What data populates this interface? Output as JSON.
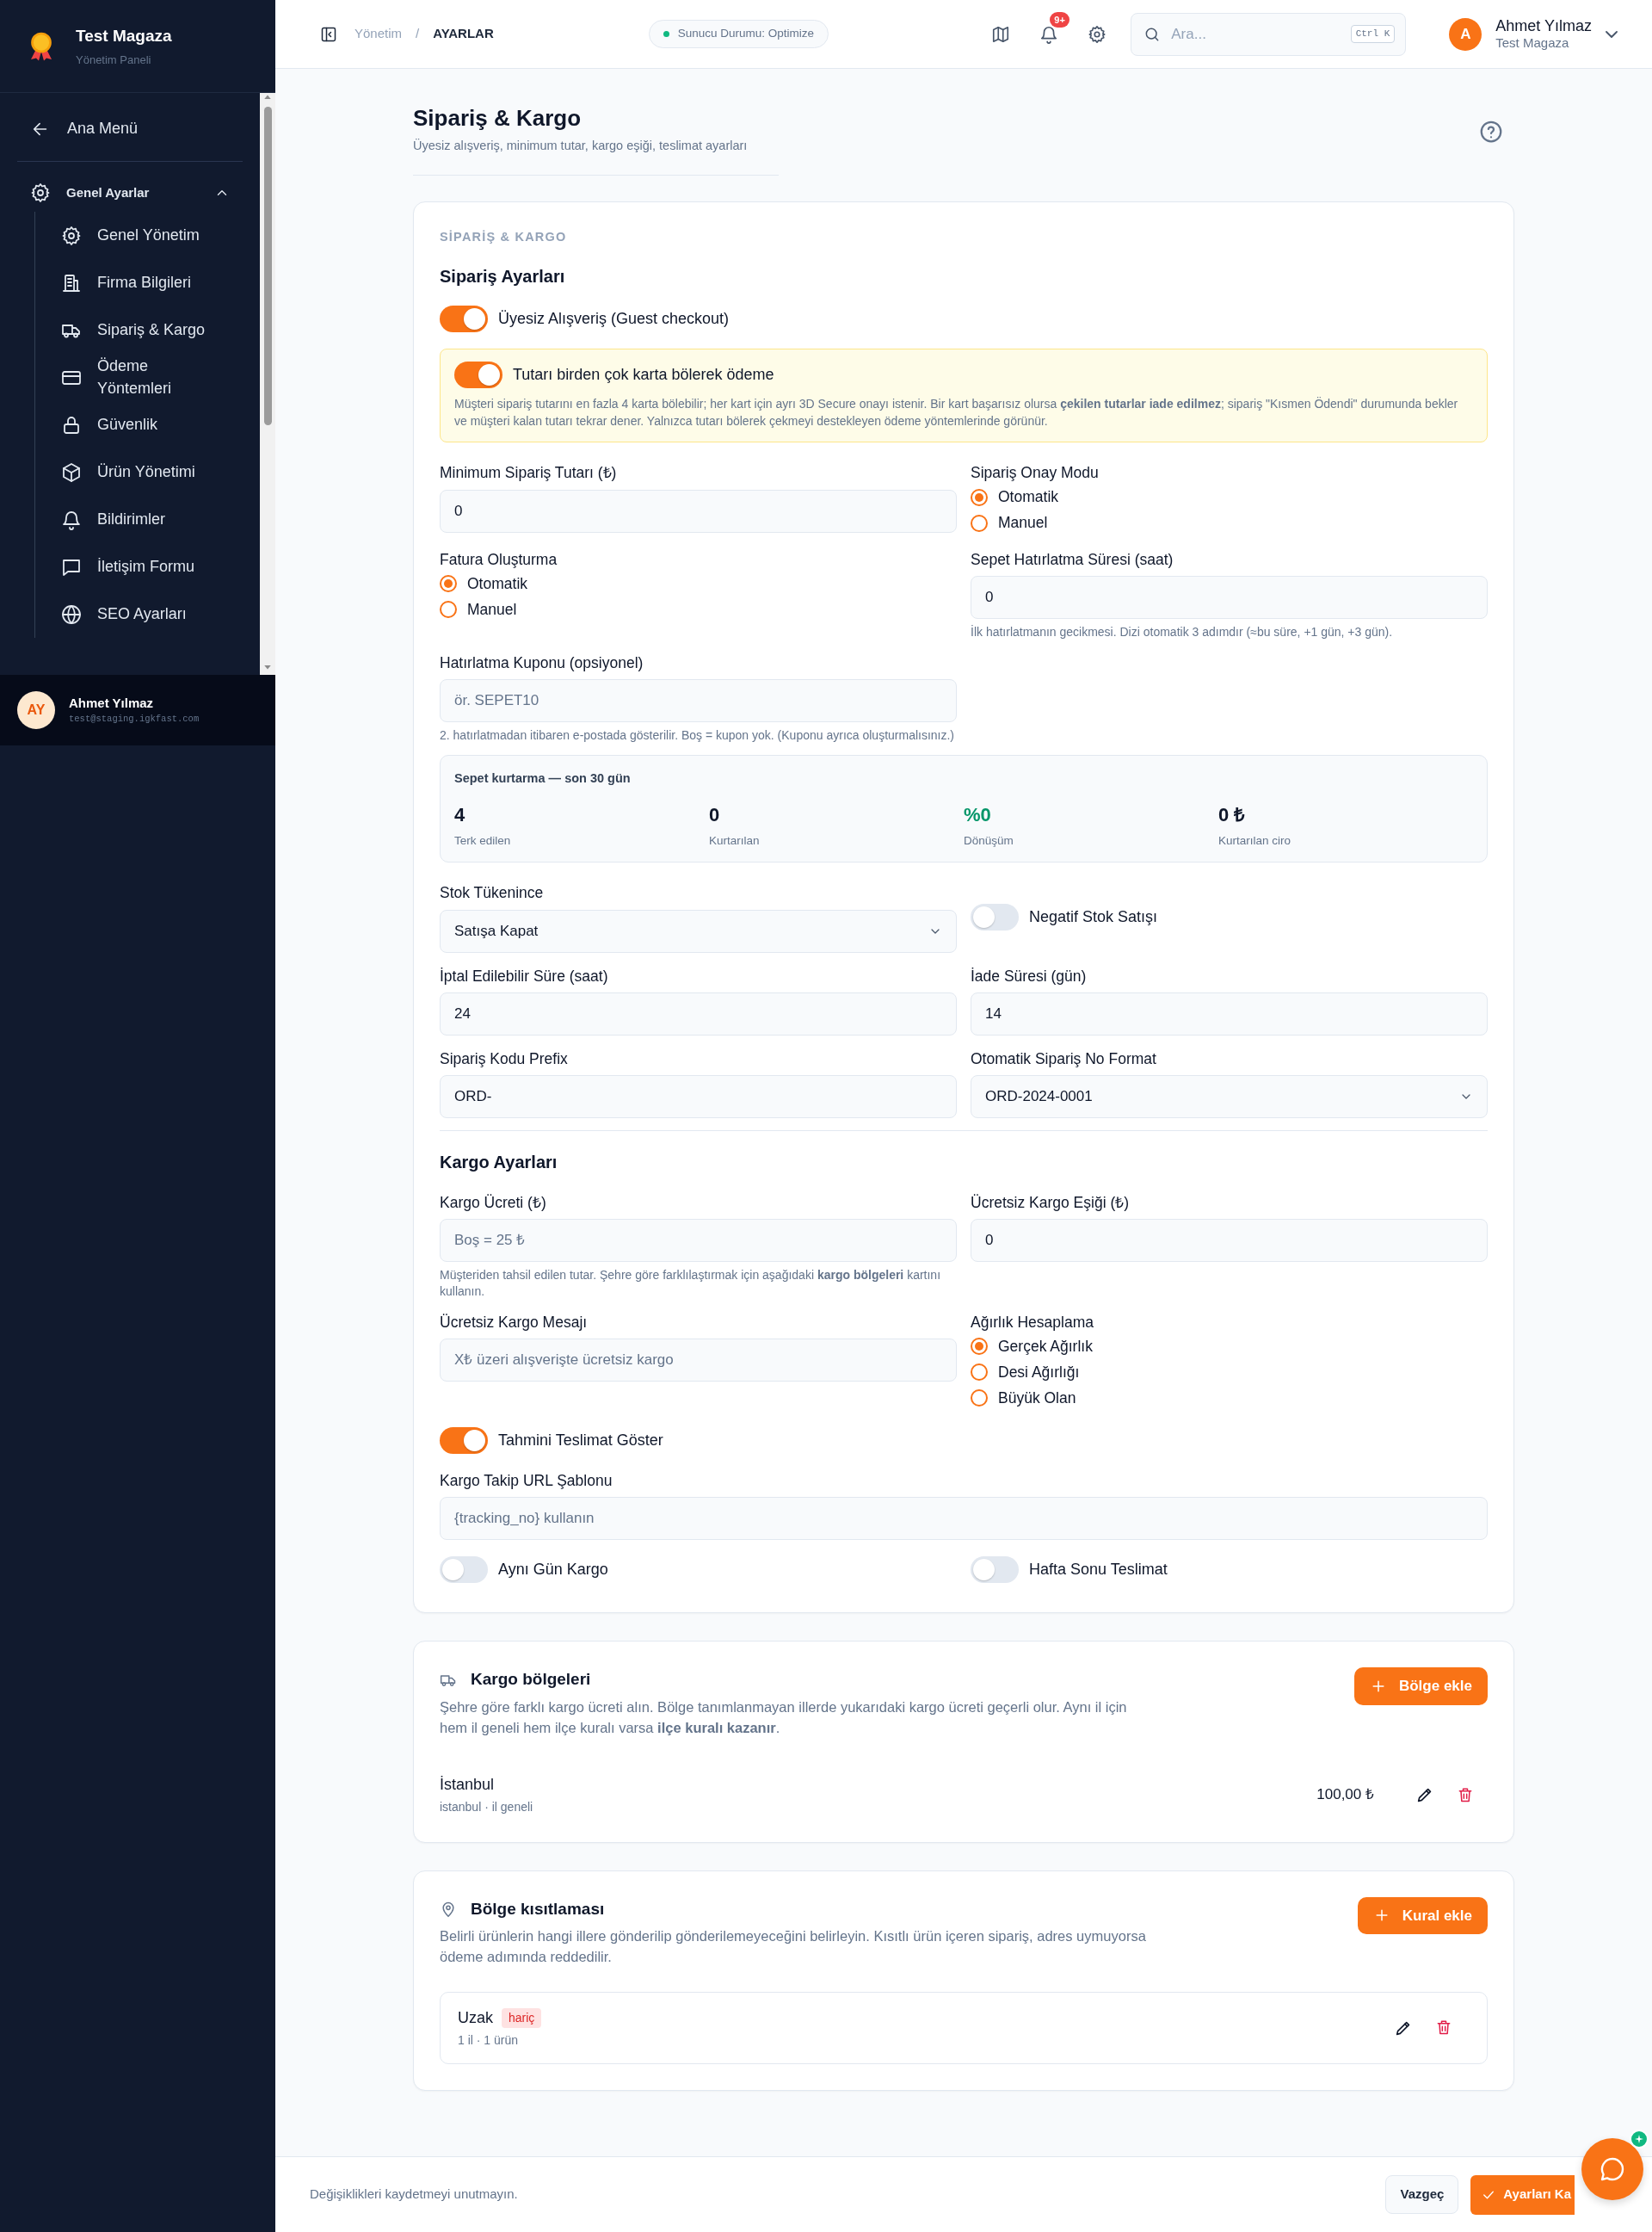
{
  "sidebar": {
    "brand": {
      "title": "Test Magaza",
      "subtitle": "Yönetim Paneli"
    },
    "back": "Ana Menü",
    "group": {
      "label": "Genel Ayarlar",
      "expanded": true,
      "items": [
        {
          "label": "Genel Yönetim"
        },
        {
          "label": "Firma Bilgileri"
        },
        {
          "label": "Sipariş & Kargo"
        },
        {
          "label": "Ödeme Yöntemleri"
        },
        {
          "label": "Güvenlik"
        },
        {
          "label": "Ürün Yönetimi"
        },
        {
          "label": "Bildirimler"
        },
        {
          "label": "İletişim Formu"
        },
        {
          "label": "SEO Ayarları"
        }
      ]
    },
    "user": {
      "initials": "AY",
      "name": "Ahmet Yılmaz",
      "email": "test@staging.igkfast.com"
    }
  },
  "header": {
    "breadcrumb": {
      "items": [
        "Yönetim",
        "AYARLAR"
      ],
      "separator": "/"
    },
    "status": "Sunucu Durumu: Optimize",
    "notifications": "9+",
    "search": {
      "placeholder": "Ara...",
      "shortcut": "Ctrl K"
    },
    "user": {
      "initial": "A",
      "name": "Ahmet Yılmaz",
      "store": "Test Magaza"
    }
  },
  "page": {
    "title": "Sipariş & Kargo",
    "subtitle": "Üyesiz alışveriş, minimum tutar, kargo eşiği, teslimat ayarları"
  },
  "settings": {
    "section_label": "SİPARİŞ & KARGO",
    "heading": "Sipariş Ayarları",
    "rows": [
      {
        "cells": [
          {
            "kind": "toggle",
            "label": "Üyesiz Alışveriş (Guest checkout)",
            "on": true
          }
        ]
      },
      {
        "cells": [
          {
            "kind": "notice",
            "wide": true,
            "label": "Tutarı birden çok karta bölerek ödeme",
            "on": true,
            "text": "Müşteri sipariş tutarını en fazla 4 karta bölebilir; her kart için ayrı 3D Secure onayı istenir. Bir kart başarısız olursa **çekilen tutarlar iade edilmez**; sipariş \"Kısmen Ödendi\" durumunda bekler ve müşteri kalan tutarı tekrar dener. Yalnızca tutarı bölerek çekmeyi destekleyen ödeme yöntemlerinde görünür."
          }
        ]
      },
      {
        "cells": [
          {
            "kind": "input",
            "label": "Minimum Sipariş Tutarı (₺)",
            "value": "0"
          },
          {
            "kind": "radio",
            "label": "Sipariş Onay Modu",
            "options": [
              {
                "label": "Otomatik",
                "selected": true
              },
              {
                "label": "Manuel",
                "selected": false
              }
            ]
          }
        ]
      },
      {
        "cells": [
          {
            "kind": "radio",
            "label": "Fatura Oluşturma",
            "options": [
              {
                "label": "Otomatik",
                "selected": true
              },
              {
                "label": "Manuel",
                "selected": false
              }
            ]
          },
          {
            "kind": "input",
            "label": "Sepet Hatırlatma Süresi (saat)",
            "value": "0",
            "hint": "İlk hatırlatmanın gecikmesi. Dizi otomatik 3 adımdır (≈bu süre, +1 gün, +3 gün)."
          }
        ]
      },
      {
        "cells": [
          {
            "kind": "input",
            "label": "Hatırlatma Kuponu (opsiyonel)",
            "placeholder": "ör. SEPET10",
            "hint": "2. hatırlatmadan itibaren e-postada gösterilir. Boş = kupon yok. (Kuponu ayrıca oluşturmalısınız.)"
          }
        ]
      },
      {
        "cells": [
          {
            "kind": "stats",
            "wide": true,
            "title": "Sepet kurtarma — son 30 gün",
            "items": [
              {
                "value": "4",
                "label": "Terk edilen",
                "color": "#0f172a"
              },
              {
                "value": "0",
                "label": "Kurtarılan",
                "color": "#0f172a"
              },
              {
                "value": "%0",
                "label": "Dönüşüm",
                "color": "#059669"
              },
              {
                "value": "0 ₺",
                "label": "Kurtarılan ciro",
                "color": "#0f172a"
              }
            ]
          }
        ]
      },
      {
        "cells": [
          {
            "kind": "select",
            "label": "Stok Tükenince",
            "value": "Satışa Kapat"
          },
          {
            "kind": "toggle",
            "label": "Negatif Stok Satışı",
            "on": false
          }
        ]
      },
      {
        "cells": [
          {
            "kind": "input",
            "label": "İptal Edilebilir Süre (saat)",
            "value": "24"
          },
          {
            "kind": "input",
            "label": "İade Süresi (gün)",
            "value": "14"
          }
        ]
      },
      {
        "cells": [
          {
            "kind": "input",
            "label": "Sipariş Kodu Prefix",
            "value": "ORD-"
          },
          {
            "kind": "select",
            "label": "Otomatik Sipariş No Format",
            "value": "ORD-2024-0001"
          }
        ]
      },
      {
        "cells": [
          {
            "kind": "section",
            "wide": true,
            "text": "Kargo Ayarları"
          }
        ]
      },
      {
        "cells": [
          {
            "kind": "input",
            "label": "Kargo Ücreti (₺)",
            "placeholder": "Boş = 25 ₺",
            "hint": "Müşteriden tahsil edilen tutar. Şehre göre farklılaştırmak için aşağıdaki **kargo bölgeleri** kartını kullanın."
          },
          {
            "kind": "input",
            "label": "Ücretsiz Kargo Eşiği (₺)",
            "value": "0"
          }
        ]
      },
      {
        "cells": [
          {
            "kind": "input",
            "label": "Ücretsiz Kargo Mesajı",
            "placeholder": "X₺ üzeri alışverişte ücretsiz kargo"
          },
          {
            "kind": "radio",
            "label": "Ağırlık Hesaplama",
            "options": [
              {
                "label": "Gerçek Ağırlık",
                "selected": true
              },
              {
                "label": "Desi Ağırlığı",
                "selected": false
              },
              {
                "label": "Büyük Olan",
                "selected": false
              }
            ]
          }
        ]
      },
      {
        "cells": [
          {
            "kind": "toggle",
            "label": "Tahmini Teslimat Göster",
            "on": true
          }
        ]
      },
      {
        "cells": [
          {
            "kind": "input",
            "wide": true,
            "label": "Kargo Takip URL Şablonu",
            "placeholder": "{tracking_no} kullanın"
          }
        ]
      },
      {
        "cells": [
          {
            "kind": "toggle",
            "label": "Aynı Gün Kargo",
            "on": false
          },
          {
            "kind": "toggle",
            "label": "Hafta Sonu Teslimat",
            "on": false
          }
        ]
      }
    ]
  },
  "zones": {
    "title": "Kargo bölgeleri",
    "text": "Şehre göre farklı kargo ücreti alın. Bölge tanımlanmayan illerde yukarıdaki kargo ücreti geçerli olur. Aynı il için hem il geneli hem ilçe kuralı varsa **ilçe kuralı kazanır**.",
    "button": "Bölge ekle",
    "items": [
      {
        "name": "İstanbul",
        "meta": "istanbul · il geneli",
        "price": "100,00 ₺"
      }
    ]
  },
  "restrictions": {
    "title": "Bölge kısıtlaması",
    "text": "Belirli ürünlerin hangi illere gönderilip gönderilemeyeceğini belirleyin. Kısıtlı ürün içeren sipariş, adres uymuyorsa ödeme adımında reddedilir.",
    "button": "Kural ekle",
    "items": [
      {
        "name": "Uzak",
        "tag": "hariç",
        "meta": "1 il · 1 ürün"
      }
    ]
  },
  "footer": {
    "note": "Değişiklikleri kaydetmeyi unutmayın.",
    "cancel": "Vazgeç",
    "save": "Ayarları Ka"
  }
}
